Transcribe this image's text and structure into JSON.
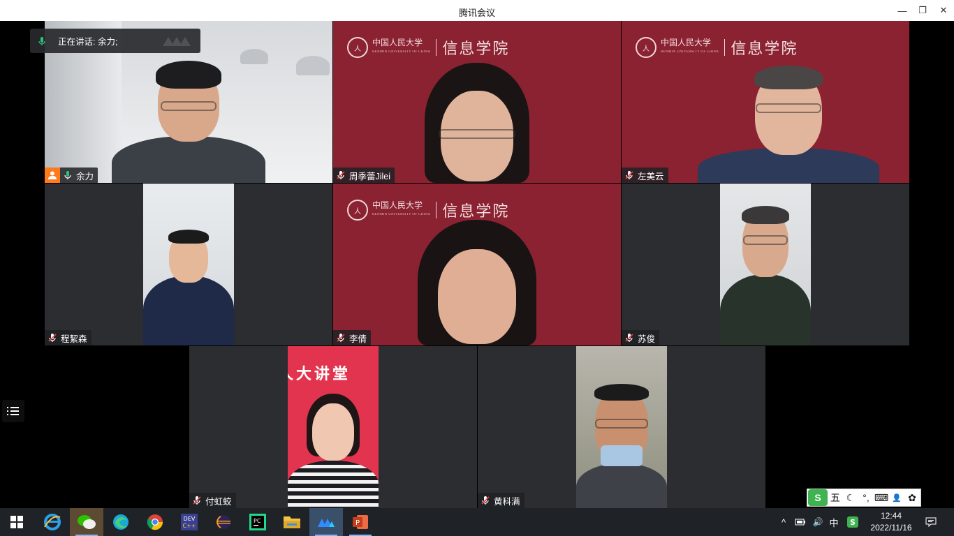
{
  "window": {
    "title": "腾讯会议",
    "minimize_label": "—",
    "restore_label": "❐",
    "close_label": "✕"
  },
  "speaking_indicator": {
    "label": "正在讲话: 余力;",
    "accent": "#2fc27a"
  },
  "participants": [
    {
      "name": "余力",
      "mic": "on",
      "host": true,
      "active_speaker": true
    },
    {
      "name": "周季蕾Jilei",
      "mic": "muted",
      "background": "信息学院"
    },
    {
      "name": "左美云",
      "mic": "muted",
      "background": "信息学院"
    },
    {
      "name": "程絜森",
      "mic": "muted"
    },
    {
      "name": "李倩",
      "mic": "muted",
      "background": "信息学院"
    },
    {
      "name": "苏俊",
      "mic": "muted"
    },
    {
      "name": "付虹蛟",
      "mic": "muted"
    },
    {
      "name": "黄科满",
      "mic": "muted"
    }
  ],
  "background_banner": {
    "seal_text": "人",
    "university_cn": "中国人民大学",
    "university_en": "RENMIN UNIVERSITY OF CHINA",
    "college": "信息学院",
    "color": "#8a2231"
  },
  "lecture_banner": "人大讲堂",
  "ime_toolbar": {
    "logo": "S",
    "mode": "五",
    "moon": "☾",
    "punct": "°,",
    "keyboard": "⌨",
    "user": "👤",
    "skin": "✿"
  },
  "taskbar": {
    "apps": [
      "windows-start",
      "internet-explorer",
      "wechat",
      "edge",
      "chrome",
      "dev-cpp",
      "eclipse",
      "pycharm",
      "file-explorer",
      "tencent-meeting",
      "powerpoint"
    ],
    "tray": {
      "chevron": "^",
      "input_lang": "中",
      "volume": "🔊"
    },
    "clock_time": "12:44",
    "clock_date": "2022/11/16"
  }
}
